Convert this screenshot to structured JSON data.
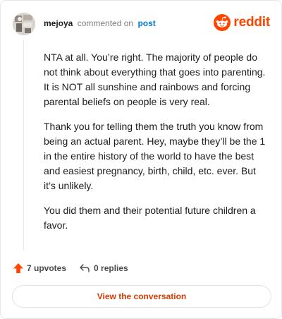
{
  "header": {
    "username": "mejoya",
    "action": "commented on",
    "post_link": "post"
  },
  "brand": {
    "wordmark": "reddit",
    "color": "#ff4500"
  },
  "comment": {
    "paragraphs": [
      "NTA at all. You’re right. The majority of people do not think about everything that goes into parenting. It is NOT all sunshine and rainbows and forcing parental beliefs on people is very real.",
      "Thank you for telling them the truth you know from being an actual parent. Hey, maybe they’ll be the 1 in the entire history of the world to have the best and easiest pregnancy, birth, child, etc. ever. But it’s unlikely.",
      "You did them and their potential future children a favor."
    ]
  },
  "footer": {
    "upvotes": "7 upvotes",
    "replies": "0 replies",
    "upvote_icon": "upvote-arrow-icon",
    "reply_icon": "reply-arrow-icon"
  },
  "cta": {
    "label": "View the conversation"
  },
  "colors": {
    "accent": "#ff4500",
    "link": "#0079d3",
    "cta_text": "#d93a00"
  }
}
